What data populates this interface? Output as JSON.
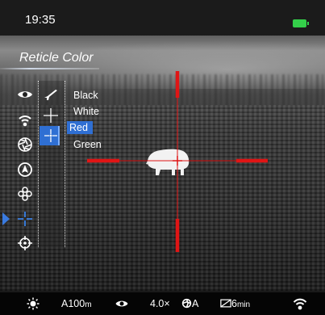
{
  "status": {
    "time": "19:35",
    "battery_color": "#34d04a"
  },
  "menu": {
    "title": "Reticle Color",
    "icons": [
      "eye-icon",
      "wifi-icon",
      "aperture-icon",
      "compass-icon",
      "pip-icon",
      "reticle-icon",
      "crosshair-settings-icon"
    ],
    "selected_icon": "reticle-icon",
    "sub_icons": [
      "rifle-icon",
      "reticle-shape-icon",
      "reticle-color-icon"
    ],
    "selected_sub_icon": "reticle-color-icon",
    "color_options": [
      "Black",
      "White",
      "Red",
      "Green"
    ],
    "selected_color": "Red",
    "accent": "#2f6fd3"
  },
  "reticle": {
    "color": "#e01515"
  },
  "bottom_bar": {
    "distance": "A100",
    "distance_unit": "m",
    "zoom": "4.0×",
    "mode": "A",
    "timer": "6",
    "timer_unit": "min"
  }
}
